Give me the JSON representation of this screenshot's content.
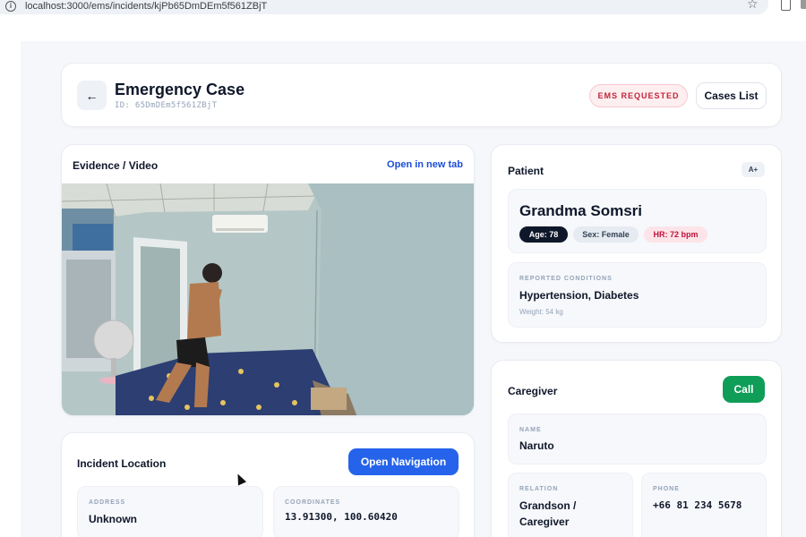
{
  "browser": {
    "url": "localhost:3000/ems/incidents/kjPb65DmDEm5f561ZBjT"
  },
  "header": {
    "back_label": "←",
    "title": "Emergency Case",
    "case_id": "ID: 65DmDEm5f561ZBjT",
    "status_badge": "EMS REQUESTED",
    "cases_list_label": "Cases List"
  },
  "evidence": {
    "title": "Evidence / Video",
    "open_new_tab_label": "Open in new tab"
  },
  "patient": {
    "title": "Patient",
    "blood_type": "A+",
    "name": "Grandma Somsri",
    "age_chip": "Age: 78",
    "sex_chip": "Sex: Female",
    "hr_chip": "HR: 72 bpm",
    "conditions_label": "REPORTED CONDITIONS",
    "conditions": "Hypertension, Diabetes",
    "weight": "Weight: 54 kg"
  },
  "caregiver": {
    "title": "Caregiver",
    "call_label": "Call",
    "name_label": "NAME",
    "name": "Naruto",
    "relation_label": "RELATION",
    "relation_line1": "Grandson /",
    "relation_line2": "Caregiver",
    "phone_label": "PHONE",
    "phone": "+66 81 234 5678"
  },
  "location": {
    "title": "Incident Location",
    "open_navigation_label": "Open Navigation",
    "address_label": "ADDRESS",
    "address": "Unknown",
    "coordinates_label": "COORDINATES",
    "coordinates": "13.91300, 100.60420"
  },
  "colors": {
    "primary_blue": "#2563eb",
    "call_green": "#0f9d58",
    "ems_red": "#c0263a",
    "background": "#f5f7fa"
  }
}
